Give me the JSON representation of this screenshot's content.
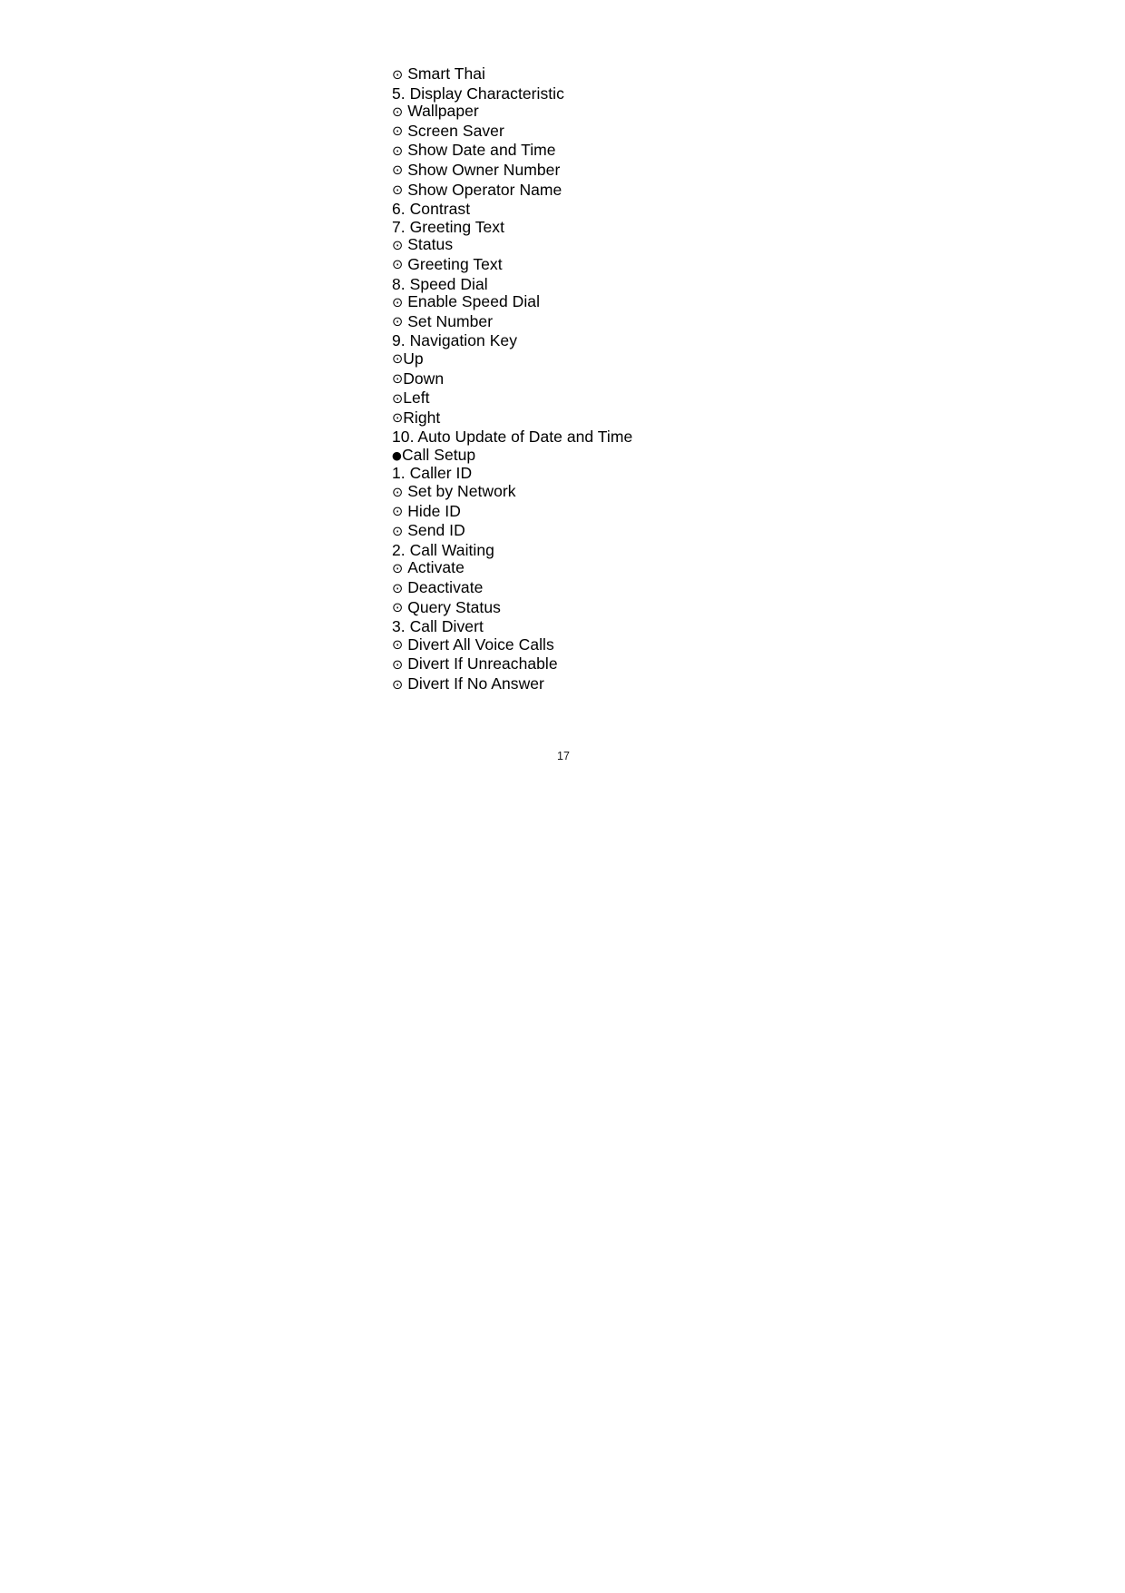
{
  "document": {
    "type": "mobile-phone-user-manual-menu-outline",
    "page_label": "17",
    "bullet_glyphs": {
      "open_circled_dot": "⊙",
      "filled_circle": "●"
    },
    "text_color": "#000000",
    "background_color": "#ffffff"
  },
  "outline": {
    "lines": [
      {
        "marker": "open",
        "spaced": true,
        "text": "Smart Thai"
      },
      {
        "marker": "none",
        "spaced": false,
        "text": "5. Display Characteristic"
      },
      {
        "marker": "open",
        "spaced": true,
        "text": "Wallpaper"
      },
      {
        "marker": "open",
        "spaced": true,
        "text": "Screen Saver"
      },
      {
        "marker": "open",
        "spaced": true,
        "text": "Show Date and Time"
      },
      {
        "marker": "open",
        "spaced": true,
        "text": "Show Owner Number"
      },
      {
        "marker": "open",
        "spaced": true,
        "text": "Show Operator Name"
      },
      {
        "marker": "none",
        "spaced": false,
        "text": "6. Contrast"
      },
      {
        "marker": "none",
        "spaced": false,
        "text": "7. Greeting Text"
      },
      {
        "marker": "open",
        "spaced": true,
        "text": "Status"
      },
      {
        "marker": "open",
        "spaced": true,
        "text": "Greeting Text"
      },
      {
        "marker": "none",
        "spaced": false,
        "text": "8. Speed Dial"
      },
      {
        "marker": "open",
        "spaced": true,
        "text": "Enable Speed Dial"
      },
      {
        "marker": "open",
        "spaced": true,
        "text": "Set Number"
      },
      {
        "marker": "none",
        "spaced": false,
        "text": "9. Navigation Key"
      },
      {
        "marker": "open",
        "spaced": false,
        "text": "Up"
      },
      {
        "marker": "open",
        "spaced": false,
        "text": "Down"
      },
      {
        "marker": "open",
        "spaced": false,
        "text": "Left"
      },
      {
        "marker": "open",
        "spaced": false,
        "text": "Right"
      },
      {
        "marker": "none",
        "spaced": false,
        "text": "10. Auto Update of Date and Time"
      },
      {
        "marker": "filled",
        "spaced": false,
        "text": "Call Setup"
      },
      {
        "marker": "none",
        "spaced": false,
        "text": "1. Caller ID"
      },
      {
        "marker": "open",
        "spaced": true,
        "text": "Set by Network"
      },
      {
        "marker": "open",
        "spaced": true,
        "text": "Hide ID"
      },
      {
        "marker": "open",
        "spaced": true,
        "text": "Send ID"
      },
      {
        "marker": "none",
        "spaced": false,
        "text": "2. Call Waiting"
      },
      {
        "marker": "open",
        "spaced": true,
        "text": "Activate"
      },
      {
        "marker": "open",
        "spaced": true,
        "text": "Deactivate"
      },
      {
        "marker": "open",
        "spaced": true,
        "text": "Query Status"
      },
      {
        "marker": "none",
        "spaced": false,
        "text": "3. Call Divert"
      },
      {
        "marker": "open",
        "spaced": true,
        "text": "Divert All Voice Calls"
      },
      {
        "marker": "open",
        "spaced": true,
        "text": "Divert If Unreachable"
      },
      {
        "marker": "open",
        "spaced": true,
        "text": "Divert If No Answer"
      }
    ]
  },
  "footer": {
    "page_number": "17"
  }
}
